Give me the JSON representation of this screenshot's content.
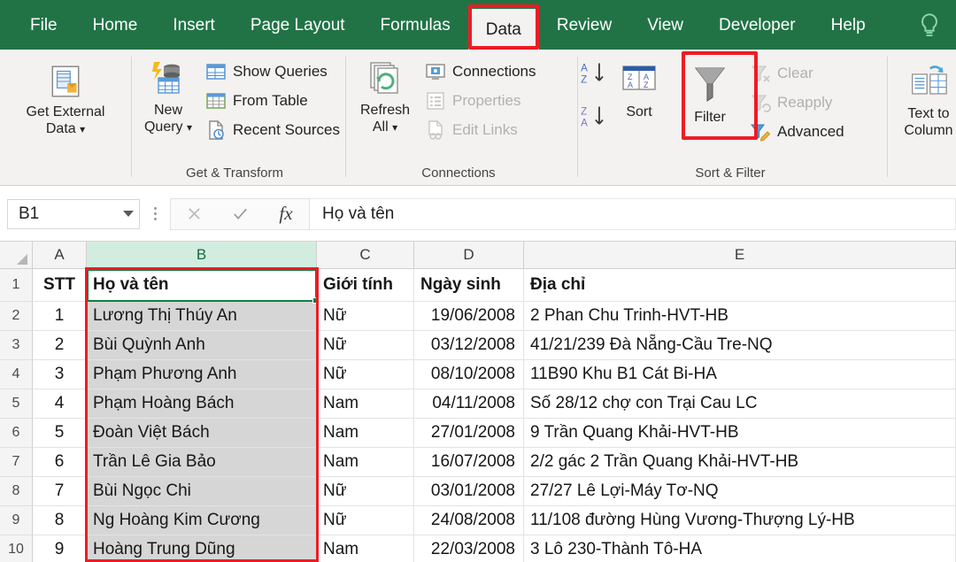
{
  "ribbon": {
    "tabs": [
      {
        "label": "File",
        "active": false
      },
      {
        "label": "Home",
        "active": false
      },
      {
        "label": "Insert",
        "active": false
      },
      {
        "label": "Page Layout",
        "active": false
      },
      {
        "label": "Formulas",
        "active": false
      },
      {
        "label": "Data",
        "active": true
      },
      {
        "label": "Review",
        "active": false
      },
      {
        "label": "View",
        "active": false
      },
      {
        "label": "Developer",
        "active": false
      },
      {
        "label": "Help",
        "active": false
      }
    ],
    "tell_me_icon": "lightbulb-icon",
    "accent_green": "#217346",
    "highlight_red": "#ee1b24",
    "groups": [
      {
        "name": "get-external-data",
        "label": "",
        "big_button": {
          "line1": "Get External",
          "line2": "Data",
          "has_dropdown": true,
          "icon": "get-external-data-icon"
        }
      },
      {
        "name": "get-and-transform",
        "label": "Get & Transform",
        "big_button": {
          "line1": "New",
          "line2": "Query",
          "has_dropdown": true,
          "icon": "new-query-icon"
        },
        "small_buttons": [
          {
            "label": "Show Queries",
            "icon": "show-queries-icon",
            "disabled": false
          },
          {
            "label": "From Table",
            "icon": "from-table-icon",
            "disabled": false
          },
          {
            "label": "Recent Sources",
            "icon": "recent-sources-icon",
            "disabled": false
          }
        ]
      },
      {
        "name": "connections",
        "label": "Connections",
        "big_button": {
          "line1": "Refresh",
          "line2": "All",
          "has_dropdown": true,
          "icon": "refresh-all-icon"
        },
        "small_buttons": [
          {
            "label": "Connections",
            "icon": "connections-icon",
            "disabled": false
          },
          {
            "label": "Properties",
            "icon": "properties-icon",
            "disabled": true
          },
          {
            "label": "Edit Links",
            "icon": "edit-links-icon",
            "disabled": true
          }
        ]
      },
      {
        "name": "sort-and-filter",
        "label": "Sort & Filter",
        "sort_az_icon": "sort-ascending-icon",
        "sort_za_icon": "sort-descending-icon",
        "sort_button": {
          "label": "Sort",
          "icon": "sort-dialog-icon"
        },
        "filter_button": {
          "label": "Filter",
          "icon": "filter-funnel-icon",
          "highlighted": true
        },
        "small_buttons": [
          {
            "label": "Clear",
            "icon": "clear-filter-icon",
            "disabled": true
          },
          {
            "label": "Reapply",
            "icon": "reapply-filter-icon",
            "disabled": true
          },
          {
            "label": "Advanced",
            "icon": "advanced-filter-icon",
            "disabled": false
          }
        ]
      },
      {
        "name": "data-tools",
        "label": "",
        "big_button": {
          "line1": "Text to",
          "line2": "Column",
          "has_dropdown": false,
          "icon": "text-to-columns-icon"
        }
      }
    ]
  },
  "formula_bar": {
    "name_box_value": "B1",
    "name_box_icon": "chevron-down-icon",
    "cancel_icon": "cancel-x-icon",
    "confirm_icon": "confirm-check-icon",
    "fx_label": "fx",
    "formula_value": "Họ và tên",
    "formula_placeholder": ""
  },
  "sheet": {
    "columns": [
      {
        "letter": "A",
        "selected": false
      },
      {
        "letter": "B",
        "selected": true
      },
      {
        "letter": "C",
        "selected": false
      },
      {
        "letter": "D",
        "selected": false
      },
      {
        "letter": "E",
        "selected": false
      }
    ],
    "row_numbers": [
      "1",
      "2",
      "3",
      "4",
      "5",
      "6",
      "7",
      "8",
      "9",
      "10"
    ],
    "active_cell": "B1",
    "headers": [
      "STT",
      "Họ và tên",
      "Giới tính",
      "Ngày sinh",
      "Địa chỉ"
    ],
    "rows": [
      [
        "1",
        "Lương Thị Thúy An",
        "Nữ",
        "19/06/2008",
        "2 Phan Chu Trinh-HVT-HB"
      ],
      [
        "2",
        "Bùi Quỳnh Anh",
        "Nữ",
        "03/12/2008",
        "41/21/239 Đà Nẵng-Cầu Tre-NQ"
      ],
      [
        "3",
        "Phạm Phương Anh",
        "Nữ",
        "08/10/2008",
        "11B90 Khu B1 Cát Bi-HA"
      ],
      [
        "4",
        "Phạm Hoàng Bách",
        "Nam",
        "04/11/2008",
        "Số 28/12 chợ con Trại Cau LC"
      ],
      [
        "5",
        "Đoàn Việt Bách",
        "Nam",
        "27/01/2008",
        "9 Trần Quang Khải-HVT-HB"
      ],
      [
        "6",
        "Trần Lê Gia Bảo",
        "Nam",
        "16/07/2008",
        "2/2 gác 2 Trần Quang Khải-HVT-HB"
      ],
      [
        "7",
        "Bùi Ngọc Chi",
        "Nữ",
        "03/01/2008",
        "27/27 Lê Lợi-Máy Tơ-NQ"
      ],
      [
        "8",
        "Ng Hoàng Kim Cương",
        "Nữ",
        "24/08/2008",
        "11/108 đường Hùng Vương-Thượng Lý-HB"
      ],
      [
        "9",
        "Hoàng Trung Dũng",
        "Nam",
        "22/03/2008",
        "3 Lô 230-Thành Tô-HA"
      ]
    ]
  }
}
